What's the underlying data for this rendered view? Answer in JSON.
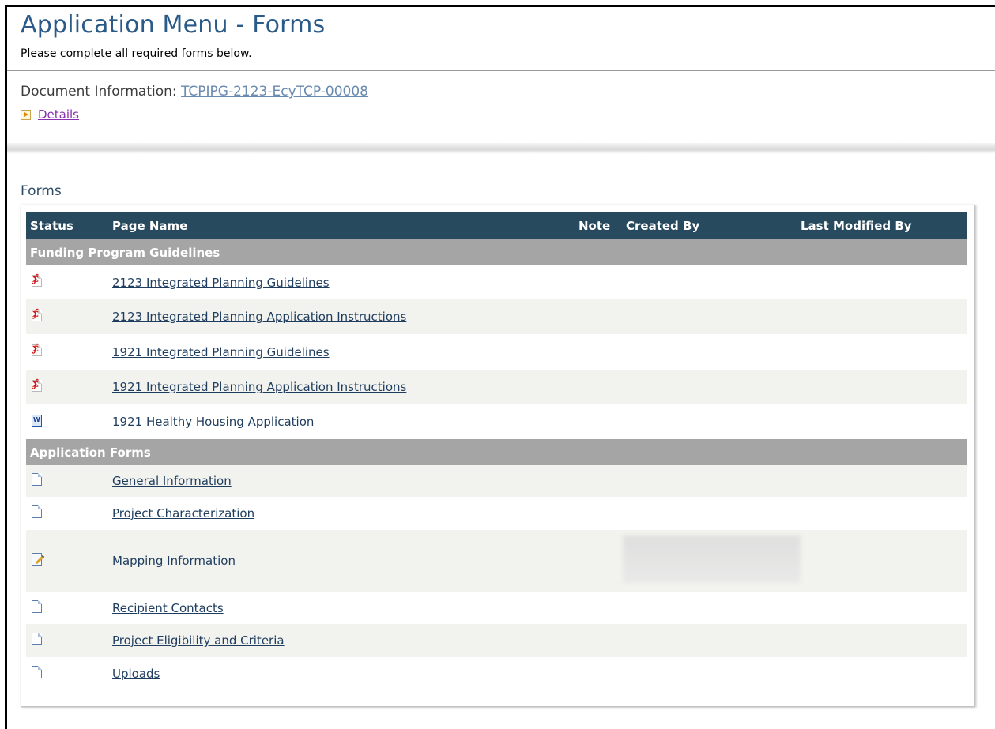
{
  "page": {
    "title": "Application Menu - Forms",
    "subtitle": "Please complete all required forms below."
  },
  "document": {
    "label": "Document Information: ",
    "id": "TCPIPG-2123-EcyTCP-00008",
    "details_label": "Details"
  },
  "forms": {
    "section_label": "Forms",
    "columns": {
      "status": "Status",
      "page_name": "Page Name",
      "note": "Note",
      "created_by": "Created By",
      "last_modified_by": "Last Modified By"
    },
    "groups": [
      {
        "name": "Funding Program Guidelines",
        "rows": [
          {
            "icon": "pdf-icon",
            "name": "2123 Integrated Planning Guidelines"
          },
          {
            "icon": "pdf-icon",
            "name": "2123 Integrated Planning Application Instructions"
          },
          {
            "icon": "pdf-icon",
            "name": "1921 Integrated Planning Guidelines"
          },
          {
            "icon": "pdf-icon",
            "name": "1921 Integrated Planning Application Instructions"
          },
          {
            "icon": "word-doc-icon",
            "name": "1921 Healthy Housing Application"
          }
        ]
      },
      {
        "name": "Application Forms",
        "rows": [
          {
            "icon": "document-icon",
            "name": "General Information"
          },
          {
            "icon": "document-icon",
            "name": "Project Characterization"
          },
          {
            "icon": "edit-document-icon",
            "name": "Mapping Information"
          },
          {
            "icon": "document-icon",
            "name": "Recipient Contacts"
          },
          {
            "icon": "document-icon",
            "name": "Project Eligibility and Criteria"
          },
          {
            "icon": "document-icon",
            "name": "Uploads"
          }
        ]
      }
    ]
  },
  "colors": {
    "title": "#2a5a88",
    "table_header_bg": "#274a5e",
    "group_header_bg": "#a5a5a5",
    "link": "#1f3d5e",
    "visited_link": "#8a2fb0"
  }
}
